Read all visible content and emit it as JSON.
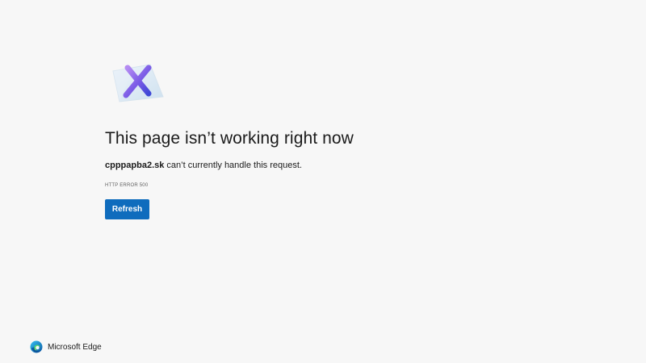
{
  "page": {
    "title": "This page isn’t working right now",
    "message": {
      "domain": "cpppapba2.sk",
      "text": " can’t currently handle this request."
    },
    "error_code": "HTTP ERROR 500",
    "refresh_label": "Refresh"
  },
  "footer": {
    "brand_name": "Microsoft Edge"
  },
  "icons": {
    "illustration": "error-x-icon",
    "brand_logo": "edge-logo-icon"
  },
  "colors": {
    "background": "#f7f7f7",
    "button": "#0f6cbd",
    "text": "#1b1b1b"
  }
}
